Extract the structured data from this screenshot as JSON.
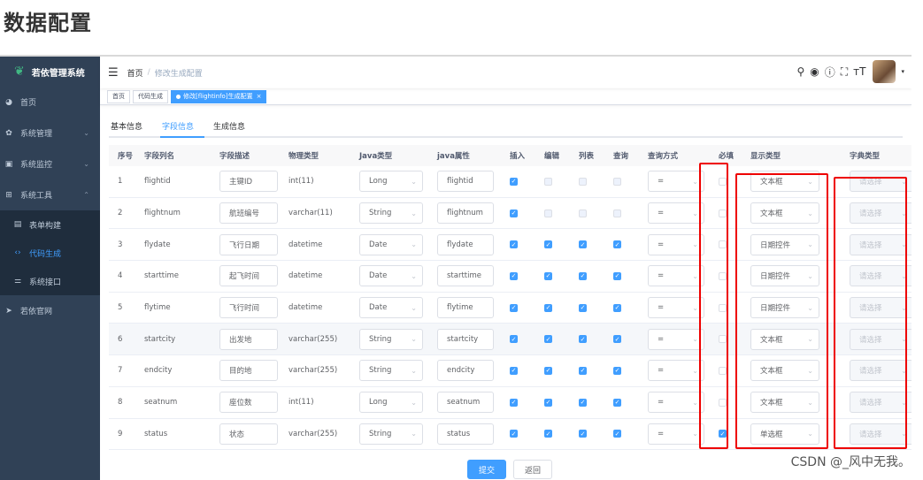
{
  "page_heading": "数据配置",
  "sidebar": {
    "logo": "若依管理系统",
    "items": [
      {
        "label": "首页",
        "icon": "dashboard-icon",
        "arrow": ""
      },
      {
        "label": "系统管理",
        "icon": "gear-icon",
        "arrow": "⌄"
      },
      {
        "label": "系统监控",
        "icon": "monitor-icon",
        "arrow": "⌄"
      },
      {
        "label": "系统工具",
        "icon": "toolbox-icon",
        "arrow": "⌃"
      }
    ],
    "subitems": [
      {
        "label": "表单构建",
        "icon": "form-icon",
        "active": false
      },
      {
        "label": "代码生成",
        "icon": "code-icon",
        "active": true
      },
      {
        "label": "系统接口",
        "icon": "api-icon",
        "active": false
      }
    ],
    "external": {
      "label": "若依官网",
      "icon": "send-icon"
    }
  },
  "navbar": {
    "breadcrumb_home": "首页",
    "breadcrumb_sep": "/",
    "breadcrumb_current": "修改生成配置"
  },
  "tags": [
    {
      "label": "首页",
      "active": false
    },
    {
      "label": "代码生成",
      "active": false
    },
    {
      "label": "修改[flightinfo]生成配置",
      "active": true
    }
  ],
  "tabs": [
    {
      "label": "基本信息",
      "active": false
    },
    {
      "label": "字段信息",
      "active": true
    },
    {
      "label": "生成信息",
      "active": false
    }
  ],
  "columns": [
    "序号",
    "字段列名",
    "字段描述",
    "物理类型",
    "Java类型",
    "java属性",
    "插入",
    "编辑",
    "列表",
    "查询",
    "查询方式",
    "必填",
    "显示类型",
    "字典类型"
  ],
  "rows": [
    {
      "idx": "1",
      "col": "flightid",
      "desc": "主键ID",
      "ptype": "int(11)",
      "jtype": "Long",
      "jprop": "flightid",
      "ins": true,
      "edit": false,
      "list": false,
      "query": false,
      "qmode": "=",
      "req": false,
      "show": "文本框",
      "dict": "请选择",
      "edit_dis": true,
      "list_dis": true,
      "query_dis": true
    },
    {
      "idx": "2",
      "col": "flightnum",
      "desc": "航班编号",
      "ptype": "varchar(11)",
      "jtype": "String",
      "jprop": "flightnum",
      "ins": true,
      "edit": false,
      "list": false,
      "query": false,
      "qmode": "=",
      "req": false,
      "show": "文本框",
      "dict": "请选择",
      "edit_dis": true,
      "list_dis": true,
      "query_dis": true
    },
    {
      "idx": "3",
      "col": "flydate",
      "desc": "飞行日期",
      "ptype": "datetime",
      "jtype": "Date",
      "jprop": "flydate",
      "ins": true,
      "edit": true,
      "list": true,
      "query": true,
      "qmode": "=",
      "req": false,
      "show": "日期控件",
      "dict": "请选择"
    },
    {
      "idx": "4",
      "col": "starttime",
      "desc": "起飞时间",
      "ptype": "datetime",
      "jtype": "Date",
      "jprop": "starttime",
      "ins": true,
      "edit": true,
      "list": true,
      "query": true,
      "qmode": "=",
      "req": false,
      "show": "日期控件",
      "dict": "请选择"
    },
    {
      "idx": "5",
      "col": "flytime",
      "desc": "飞行时间",
      "ptype": "datetime",
      "jtype": "Date",
      "jprop": "flytime",
      "ins": true,
      "edit": true,
      "list": true,
      "query": true,
      "qmode": "=",
      "req": false,
      "show": "日期控件",
      "dict": "请选择"
    },
    {
      "idx": "6",
      "col": "startcity",
      "desc": "出发地",
      "ptype": "varchar(255)",
      "jtype": "String",
      "jprop": "startcity",
      "ins": true,
      "edit": true,
      "list": true,
      "query": true,
      "qmode": "=",
      "req": false,
      "show": "文本框",
      "dict": "请选择",
      "hl": true
    },
    {
      "idx": "7",
      "col": "endcity",
      "desc": "目的地",
      "ptype": "varchar(255)",
      "jtype": "String",
      "jprop": "endcity",
      "ins": true,
      "edit": true,
      "list": true,
      "query": true,
      "qmode": "=",
      "req": false,
      "show": "文本框",
      "dict": "请选择"
    },
    {
      "idx": "8",
      "col": "seatnum",
      "desc": "座位数",
      "ptype": "int(11)",
      "jtype": "Long",
      "jprop": "seatnum",
      "ins": true,
      "edit": true,
      "list": true,
      "query": true,
      "qmode": "=",
      "req": false,
      "show": "文本框",
      "dict": "请选择"
    },
    {
      "idx": "9",
      "col": "status",
      "desc": "状态",
      "ptype": "varchar(255)",
      "jtype": "String",
      "jprop": "status",
      "ins": true,
      "edit": true,
      "list": true,
      "query": true,
      "qmode": "=",
      "req": true,
      "show": "单选框",
      "dict": "请选择"
    }
  ],
  "buttons": {
    "submit": "提交",
    "back": "返回"
  },
  "watermark": "CSDN @_风中无我。",
  "colors": {
    "sidebar": "#304156",
    "primary": "#409eff",
    "highlight": "#e00000"
  }
}
